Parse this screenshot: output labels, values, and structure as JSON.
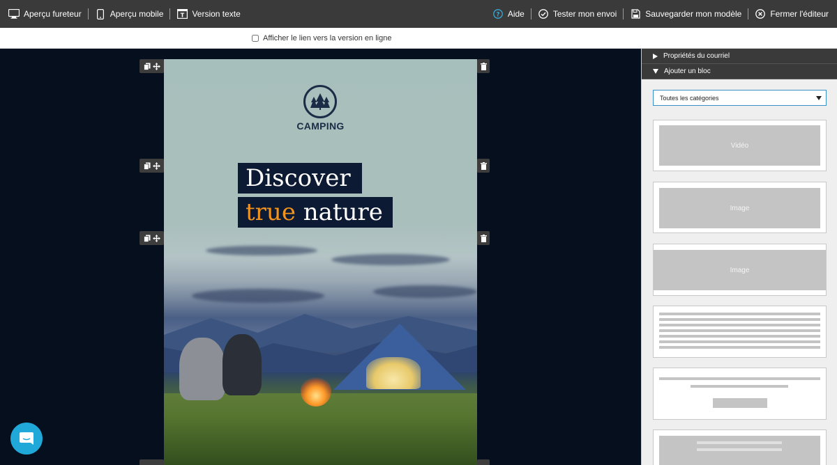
{
  "toolbar": {
    "left": [
      {
        "label": "Aperçu fureteur",
        "icon": "monitor-icon"
      },
      {
        "label": "Aperçu mobile",
        "icon": "mobile-icon"
      },
      {
        "label": "Version texte",
        "icon": "text-version-icon"
      }
    ],
    "right": [
      {
        "label": "Aide",
        "icon": "help-icon",
        "color": "#3aa8d8"
      },
      {
        "label": "Tester mon envoi",
        "icon": "check-circle-icon"
      },
      {
        "label": "Sauvegarder mon modèle",
        "icon": "save-icon"
      },
      {
        "label": "Fermer l'éditeur",
        "icon": "close-circle-icon"
      }
    ]
  },
  "subbar": {
    "checkbox_label": "Afficher le lien vers la version en ligne",
    "checked": false
  },
  "email": {
    "logo_text": "CAMPING",
    "headline_line1": "Discover",
    "headline_accent": "true",
    "headline_rest": "nature",
    "accent_color": "#f3941d",
    "headline_bg": "#0d1a33"
  },
  "panel": {
    "section1": "Propriétés du courriel",
    "section2": "Ajouter un bloc",
    "category_select": "Toutes les catégories",
    "blocks": [
      {
        "label": "Vidéo"
      },
      {
        "label": "Image"
      },
      {
        "label": "Image"
      }
    ]
  },
  "colors": {
    "toolbar_bg": "#3a3a3a",
    "canvas_bg": "#050f1d",
    "chat_bubble": "#1fa8d8"
  }
}
